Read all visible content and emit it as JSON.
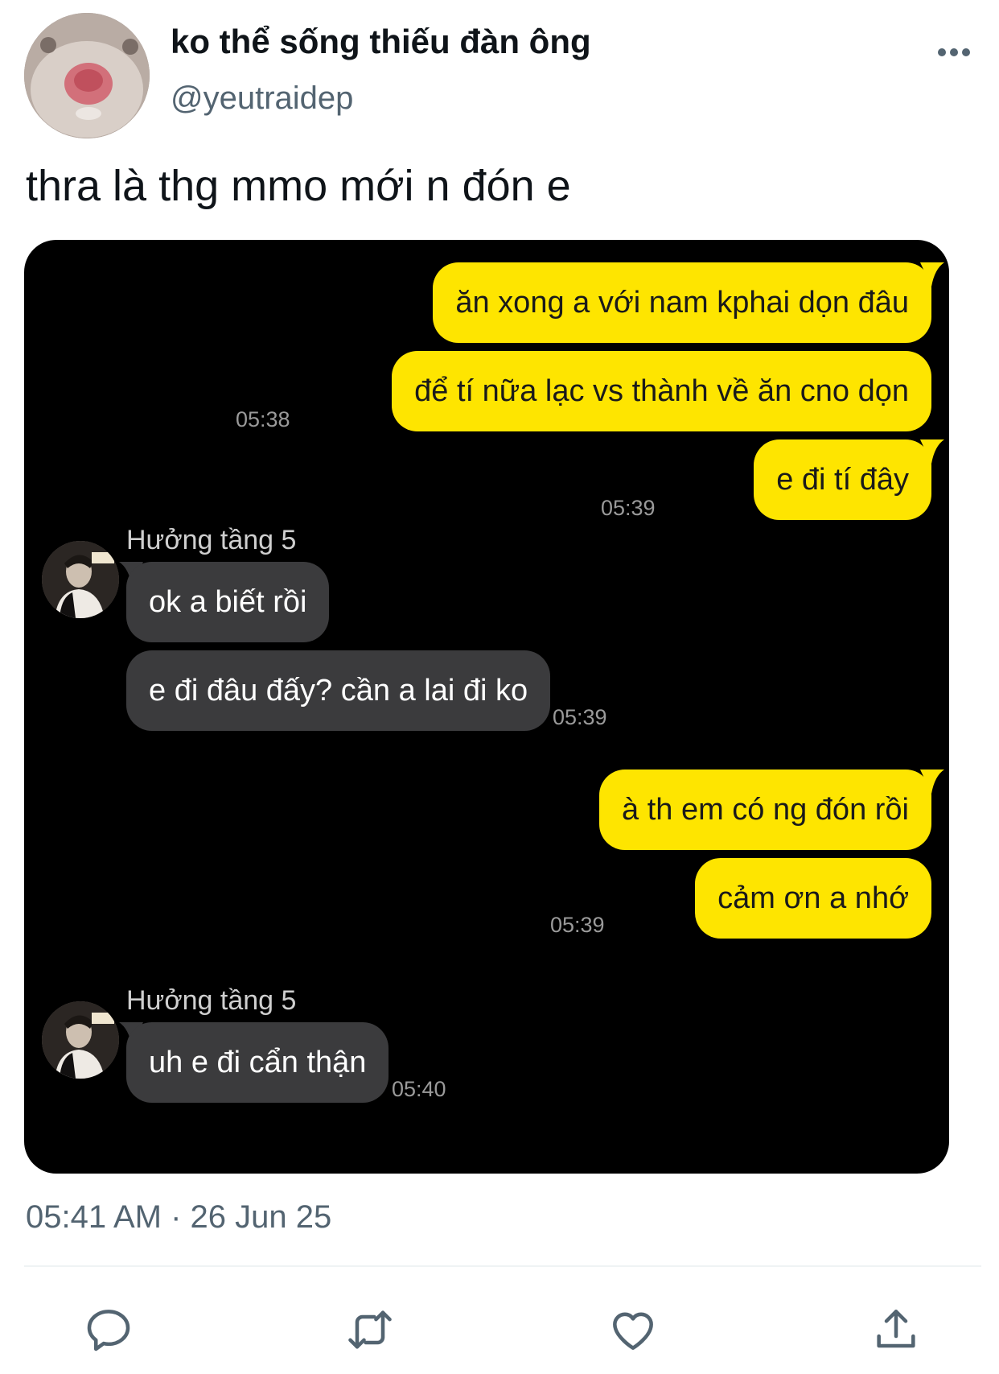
{
  "tweet": {
    "author": {
      "display_name": "ko thể sống thiếu đàn ông",
      "handle": "@yeutraidep",
      "avatar": "hamster-avatar"
    },
    "text": "thra là thg mmo mới n đón e",
    "timestamp": "05:41 AM · 26 Jun 25",
    "more_icon": "more-horizontal-icon"
  },
  "chat": {
    "contact_name": "Hưởng tầng 5",
    "colors": {
      "outgoing": "#fee500",
      "incoming": "#3b3b3d",
      "background": "#000000"
    },
    "messages": [
      {
        "dir": "out",
        "text": "ăn xong a với nam kphai dọn đâu"
      },
      {
        "dir": "out",
        "text": "để tí nữa lạc vs thành về ăn cno dọn",
        "time": "05:38"
      },
      {
        "dir": "out",
        "text": "e đi tí đây",
        "time": "05:39"
      },
      {
        "dir": "in",
        "sender": "Hưởng tầng 5",
        "text": "ok a biết rồi"
      },
      {
        "dir": "in",
        "text": "e đi đâu đấy? cần a lai đi ko",
        "time": "05:39"
      },
      {
        "dir": "out",
        "text": "à th em có ng đón rồi"
      },
      {
        "dir": "out",
        "text": "cảm ơn a nhớ",
        "time": "05:39"
      },
      {
        "dir": "in",
        "sender": "Hưởng tầng 5",
        "text": "uh e đi cẩn thận",
        "time": "05:40"
      }
    ]
  },
  "actions": [
    {
      "name": "reply",
      "icon": "reply-icon"
    },
    {
      "name": "retweet",
      "icon": "retweet-icon"
    },
    {
      "name": "like",
      "icon": "like-icon"
    },
    {
      "name": "share",
      "icon": "share-icon"
    }
  ],
  "colors": {
    "text": "#0f1419",
    "secondary": "#536471",
    "icon": "#536471"
  }
}
